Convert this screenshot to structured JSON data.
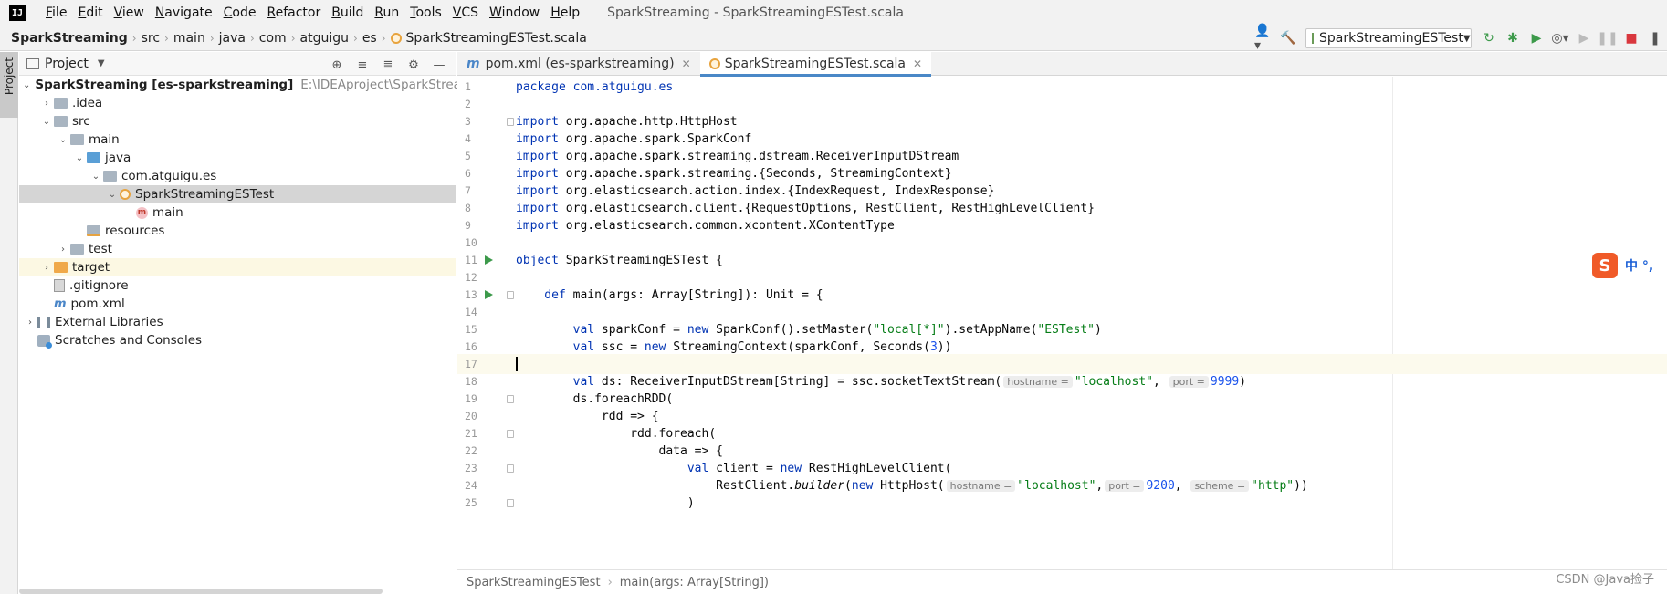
{
  "menubar": {
    "logo": "IJ",
    "items": [
      "File",
      "Edit",
      "View",
      "Navigate",
      "Code",
      "Refactor",
      "Build",
      "Run",
      "Tools",
      "VCS",
      "Window",
      "Help"
    ],
    "window_title": "SparkStreaming - SparkStreamingESTest.scala"
  },
  "navbar": {
    "crumbs": [
      "SparkStreaming",
      "src",
      "main",
      "java",
      "com",
      "atguigu",
      "es"
    ],
    "file": "SparkStreamingESTest.scala",
    "run_config": "SparkStreamingESTest"
  },
  "toolstrip": {
    "project_tab": "Project"
  },
  "project": {
    "title": "Project",
    "root_name": "SparkStreaming [es-sparkstreaming]",
    "root_path": "E:\\IDEAproject\\SparkStreaming\\S",
    "nodes": [
      ".idea",
      "src",
      "main",
      "java",
      "com.atguigu.es",
      "SparkStreamingESTest",
      "main",
      "resources",
      "test",
      "target",
      ".gitignore",
      "pom.xml",
      "External Libraries",
      "Scratches and Consoles"
    ]
  },
  "editor": {
    "tabs": [
      {
        "label": "pom.xml (es-sparkstreaming)"
      },
      {
        "label": "SparkStreamingESTest.scala"
      }
    ],
    "line_numbers": [
      "1",
      "2",
      "3",
      "4",
      "5",
      "6",
      "7",
      "8",
      "9",
      "10",
      "11",
      "12",
      "13",
      "14",
      "15",
      "16",
      "17",
      "18",
      "19",
      "20",
      "21",
      "22",
      "23",
      "24",
      "25"
    ],
    "code": {
      "l1": "package com.atguigu.es",
      "l3a": "import",
      "l3b": " org.apache.http.HttpHost",
      "l4a": "import",
      "l4b": " org.apache.spark.SparkConf",
      "l5a": "import",
      "l5b": " org.apache.spark.streaming.dstream.ReceiverInputDStream",
      "l6a": "import",
      "l6b": " org.apache.spark.streaming.{Seconds, StreamingContext}",
      "l7a": "import",
      "l7b": " org.elasticsearch.action.index.{IndexRequest, IndexResponse}",
      "l8a": "import",
      "l8b": " org.elasticsearch.client.{RequestOptions, RestClient, RestHighLevelClient}",
      "l9a": "import",
      "l9b": " org.elasticsearch.common.xcontent.XContentType",
      "l11a": "object",
      "l11b": " SparkStreamingESTest {",
      "l13a": "    def",
      "l13b": " main(args: Array[String]): Unit = {",
      "l15a": "        val",
      "l15b": " sparkConf = ",
      "l15c": "new",
      "l15d": " SparkConf().setMaster(",
      "l15e": "\"local[*]\"",
      "l15f": ").setAppName(",
      "l15g": "\"ESTest\"",
      "l15h": ")",
      "l16a": "        val",
      "l16b": " ssc = ",
      "l16c": "new",
      "l16d": " StreamingContext(sparkConf, Seconds(",
      "l16e": "3",
      "l16f": "))",
      "l18a": "        val",
      "l18b": " ds: ReceiverInputDStream[String] = ssc.socketTextStream(",
      "l18h1": "hostname =",
      "l18c": "\"localhost\"",
      "l18d": ",",
      "l18h2": "port =",
      "l18e": "9999",
      "l18f": ")",
      "l19": "        ds.foreachRDD(",
      "l20": "            rdd => {",
      "l21": "                rdd.foreach(",
      "l22": "                    data => {",
      "l23a": "                        val",
      "l23b": " client = ",
      "l23c": "new",
      "l23d": " RestHighLevelClient(",
      "l24a": "                            RestClient.",
      "l24b": "builder",
      "l24c": "(",
      "l24d": "new",
      "l24e": " HttpHost(",
      "l24h1": "hostname =",
      "l24f": "\"localhost\"",
      "l24g": ",",
      "l24h2": "port =",
      "l24i": "9200",
      "l24j": ",",
      "l24h3": "scheme =",
      "l24k": "\"http\"",
      "l24l": "))",
      "l25": "                        )"
    },
    "breadcrumb": [
      "SparkStreamingESTest",
      "main(args: Array[String])"
    ]
  },
  "ime": {
    "logo": "S",
    "text": "中 °,"
  },
  "watermark": "CSDN @Java捡子"
}
